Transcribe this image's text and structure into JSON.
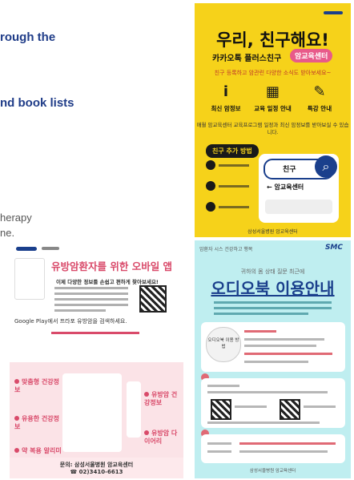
{
  "left_text": {
    "line1": "rough the",
    "line2": "nd book lists",
    "line3": "herapy",
    "line4": "ne."
  },
  "poster_yellow": {
    "title": "우리, 친구해요!",
    "subtitle_left": "카카오톡 플러스친구",
    "subtitle_badge": "암교육센터",
    "strip": "친구 등록하고 암관련 다양한 소식도 받아보세요~",
    "icons": [
      {
        "name": "info-icon",
        "glyph": "i",
        "label": "최신 암정보"
      },
      {
        "name": "calendar-icon",
        "glyph": "▦",
        "label": "교육 일정 안내"
      },
      {
        "name": "pencil-icon",
        "glyph": "✎",
        "label": "특강 안내"
      }
    ],
    "note": "매월 암교육센터 교육프로그램 일정과 최신 암정보를 받아보실 수 있습니다.",
    "add_label": "친구 추가 방법",
    "search_value": "친구",
    "back_label": "← 암교육센터",
    "footer": "삼성서울병원 암교육센터"
  },
  "poster_pink": {
    "title": "유방암환자를 위한 오바일 앱",
    "sub": "이제 다양한 정보를 손쉽고 편하게 찾아보세요!",
    "google_play_text": "Google Play에서 프라포 유방암을 검색하세요.",
    "labels_left": [
      "맞춤형 건강정보",
      "유용한 건강정보",
      "약 복용 알리미"
    ],
    "labels_right": [
      "유방암 건강정보",
      "유방암 다이어리"
    ],
    "footer_line1": "문의: 삼성서울병원 암교육센터",
    "footer_line2": "☎ 02)3410-6613"
  },
  "poster_teal": {
    "header": "암환자 시스 건강하고 행복",
    "brand": "SMC",
    "kicker": "귀하의 몸 상태 질문 최근에",
    "title": "오디오북 이용안내",
    "circle_label": "오디오북 이용 방법",
    "footer": "삼성서울병원 암교육센터"
  }
}
